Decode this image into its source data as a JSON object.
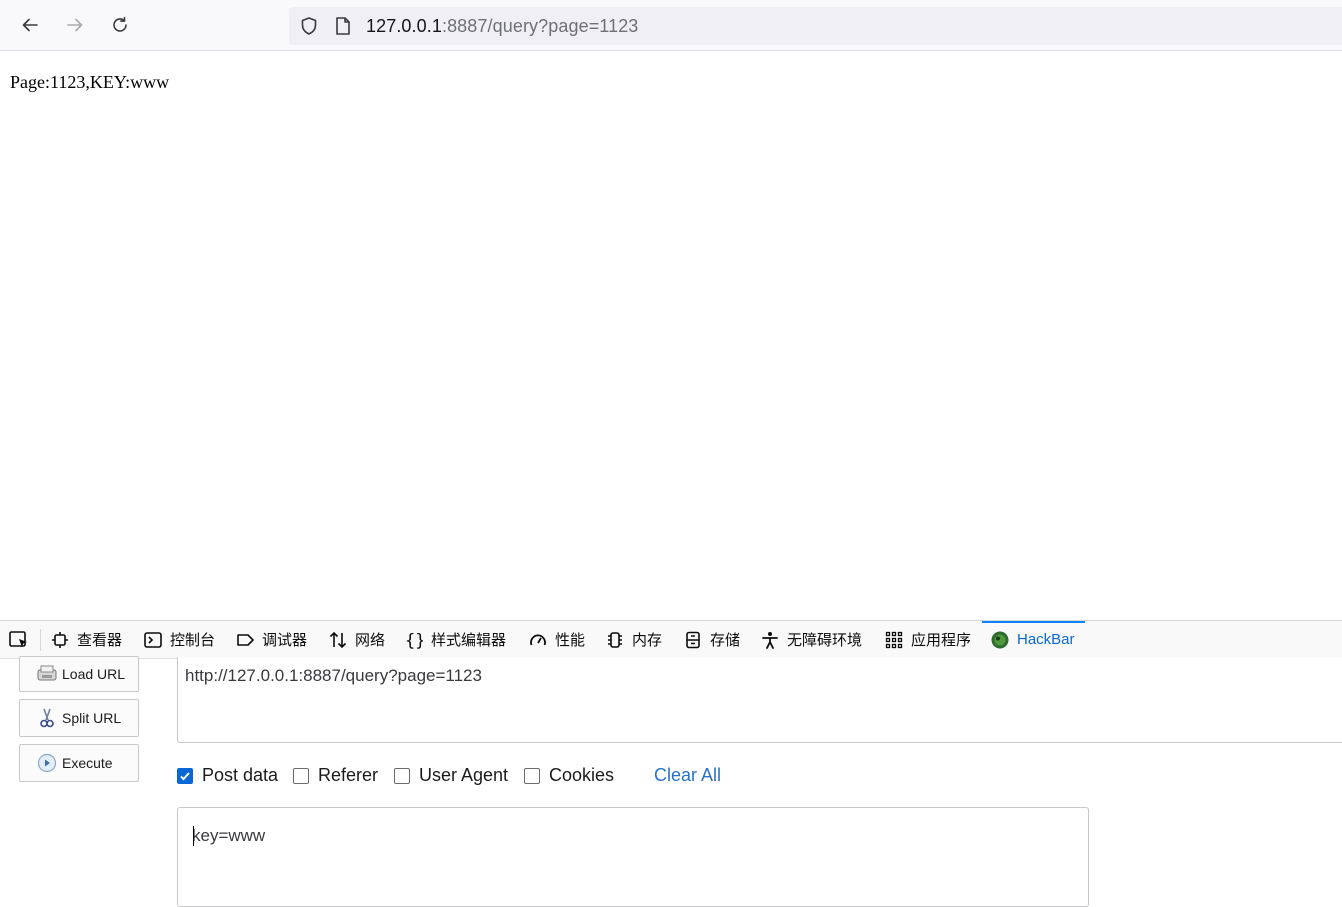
{
  "browser": {
    "url_host": "127.0.0.1",
    "url_rest": ":8887/query?page=1123"
  },
  "page": {
    "text": "Page:1123,KEY:www"
  },
  "devtools": {
    "tabs": [
      {
        "label": "查看器",
        "icon": "inspector-icon"
      },
      {
        "label": "控制台",
        "icon": "console-icon"
      },
      {
        "label": "调试器",
        "icon": "debugger-icon"
      },
      {
        "label": "网络",
        "icon": "network-icon"
      },
      {
        "label": "样式编辑器",
        "icon": "style-editor-icon"
      },
      {
        "label": "性能",
        "icon": "performance-icon"
      },
      {
        "label": "内存",
        "icon": "memory-icon"
      },
      {
        "label": "存储",
        "icon": "storage-icon"
      },
      {
        "label": "无障碍环境",
        "icon": "accessibility-icon"
      },
      {
        "label": "应用程序",
        "icon": "application-icon"
      },
      {
        "label": "HackBar",
        "icon": "hackbar-icon",
        "active": true
      }
    ]
  },
  "hackbar": {
    "load_url": "Load URL",
    "split_url": "Split URL",
    "execute": "Execute",
    "url_value": "http://127.0.0.1:8887/query?page=1123",
    "options": [
      {
        "label": "Post data",
        "checked": true
      },
      {
        "label": "Referer",
        "checked": false
      },
      {
        "label": "User Agent",
        "checked": false
      },
      {
        "label": "Cookies",
        "checked": false
      }
    ],
    "clear_all": "Clear All",
    "post_value": "key=www"
  },
  "colors": {
    "accent": "#0a68d6",
    "link": "#2a72c0"
  }
}
